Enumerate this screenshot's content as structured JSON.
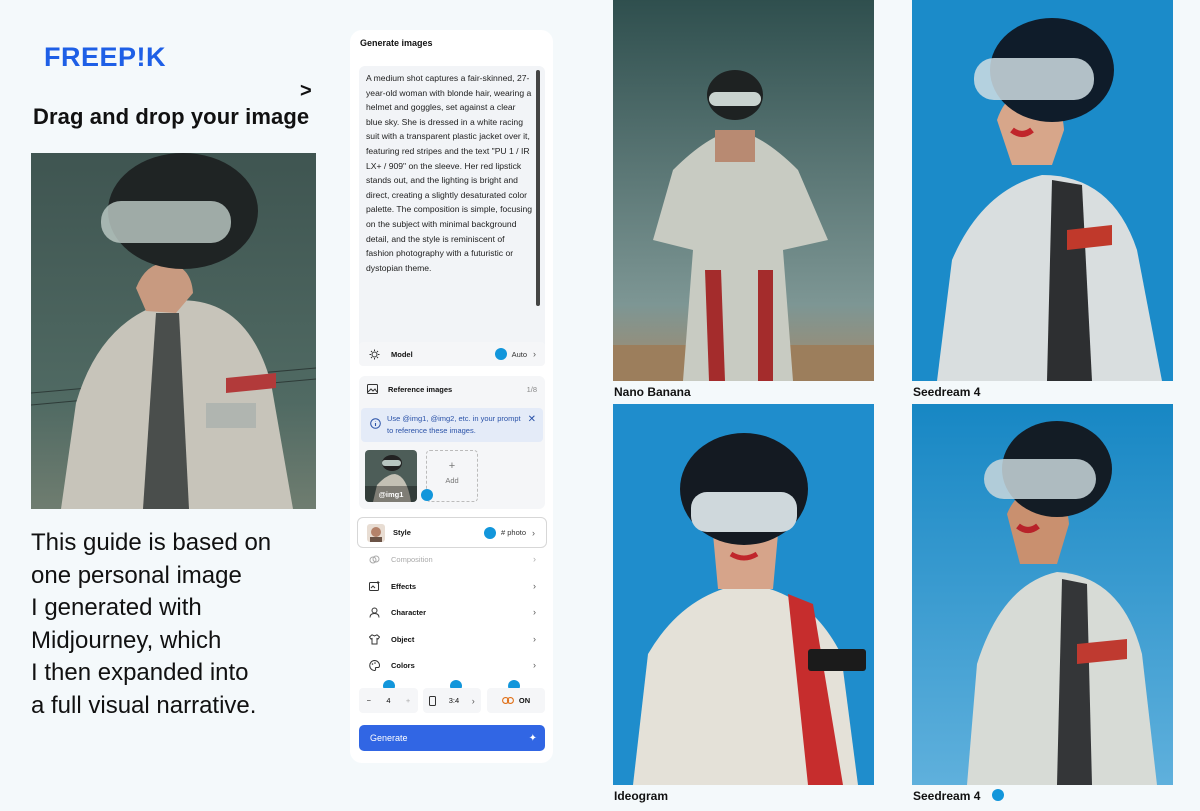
{
  "brand": {
    "logo_text": "FREEP!K",
    "color": "#1e5fe6"
  },
  "intro": {
    "arrow": ">",
    "headline": "Drag and drop your image",
    "guide_lines": [
      "This guide is based on",
      "one personal image",
      "I generated with",
      "Midjourney, which",
      "I then expanded into",
      "a full visual narrative."
    ]
  },
  "panel": {
    "title": "Generate images",
    "prompt": "A medium shot captures a fair-skinned, 27-year-old woman with blonde hair, wearing a helmet and goggles, set against a clear blue sky. She is dressed in a white racing suit with a transparent plastic jacket over it, featuring red stripes and the text \"PU 1 / IR LX+ / 909\" on the sleeve. Her red lipstick stands out, and the lighting is bright and direct, creating a slightly desaturated color palette. The composition is simple, focusing on the subject with minimal background detail, and the style is reminiscent of fashion photography with a futuristic or dystopian theme.",
    "model": {
      "label": "Model",
      "value": "Auto"
    },
    "reference": {
      "label": "Reference images",
      "count": "1/8",
      "info": "Use @img1, @img2, etc. in your prompt to reference these images.",
      "thumb_label": "@img1",
      "add_plus": "+",
      "add_label": "Add"
    },
    "style": {
      "label": "Style",
      "value": "# photo"
    },
    "menu": {
      "composition": "Composition",
      "effects": "Effects",
      "character": "Character",
      "object": "Object",
      "colors": "Colors"
    },
    "controls": {
      "minus": "−",
      "count": "4",
      "plus": "+",
      "ratio": "3:4",
      "toggle": "ON"
    },
    "generate_label": "Generate",
    "accent": "#3166e4",
    "marker_color": "#1296db"
  },
  "results": {
    "top_left": "Nano Banana",
    "top_right": "Seedream 4",
    "bottom_left": "Ideogram",
    "bottom_right": "Seedream 4"
  },
  "icons": [
    "model-icon",
    "image-icon",
    "info-icon",
    "close-icon",
    "composition-icon",
    "effects-icon",
    "character-icon",
    "object-icon",
    "colors-icon",
    "phone-icon",
    "link-icon",
    "sparkle-icon",
    "cube-icon"
  ]
}
